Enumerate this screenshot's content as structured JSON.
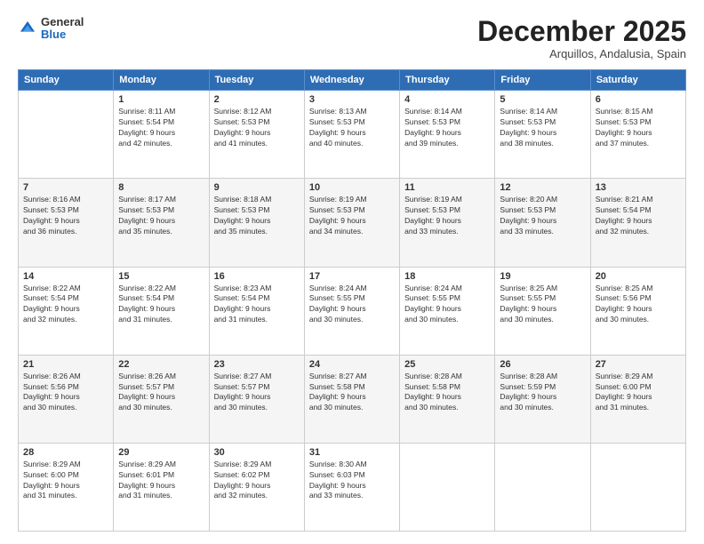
{
  "logo": {
    "general": "General",
    "blue": "Blue"
  },
  "title": "December 2025",
  "subtitle": "Arquillos, Andalusia, Spain",
  "days": [
    "Sunday",
    "Monday",
    "Tuesday",
    "Wednesday",
    "Thursday",
    "Friday",
    "Saturday"
  ],
  "weeks": [
    [
      {
        "day": "",
        "info": ""
      },
      {
        "day": "1",
        "info": "Sunrise: 8:11 AM\nSunset: 5:54 PM\nDaylight: 9 hours\nand 42 minutes."
      },
      {
        "day": "2",
        "info": "Sunrise: 8:12 AM\nSunset: 5:53 PM\nDaylight: 9 hours\nand 41 minutes."
      },
      {
        "day": "3",
        "info": "Sunrise: 8:13 AM\nSunset: 5:53 PM\nDaylight: 9 hours\nand 40 minutes."
      },
      {
        "day": "4",
        "info": "Sunrise: 8:14 AM\nSunset: 5:53 PM\nDaylight: 9 hours\nand 39 minutes."
      },
      {
        "day": "5",
        "info": "Sunrise: 8:14 AM\nSunset: 5:53 PM\nDaylight: 9 hours\nand 38 minutes."
      },
      {
        "day": "6",
        "info": "Sunrise: 8:15 AM\nSunset: 5:53 PM\nDaylight: 9 hours\nand 37 minutes."
      }
    ],
    [
      {
        "day": "7",
        "info": "Sunrise: 8:16 AM\nSunset: 5:53 PM\nDaylight: 9 hours\nand 36 minutes."
      },
      {
        "day": "8",
        "info": "Sunrise: 8:17 AM\nSunset: 5:53 PM\nDaylight: 9 hours\nand 35 minutes."
      },
      {
        "day": "9",
        "info": "Sunrise: 8:18 AM\nSunset: 5:53 PM\nDaylight: 9 hours\nand 35 minutes."
      },
      {
        "day": "10",
        "info": "Sunrise: 8:19 AM\nSunset: 5:53 PM\nDaylight: 9 hours\nand 34 minutes."
      },
      {
        "day": "11",
        "info": "Sunrise: 8:19 AM\nSunset: 5:53 PM\nDaylight: 9 hours\nand 33 minutes."
      },
      {
        "day": "12",
        "info": "Sunrise: 8:20 AM\nSunset: 5:53 PM\nDaylight: 9 hours\nand 33 minutes."
      },
      {
        "day": "13",
        "info": "Sunrise: 8:21 AM\nSunset: 5:54 PM\nDaylight: 9 hours\nand 32 minutes."
      }
    ],
    [
      {
        "day": "14",
        "info": "Sunrise: 8:22 AM\nSunset: 5:54 PM\nDaylight: 9 hours\nand 32 minutes."
      },
      {
        "day": "15",
        "info": "Sunrise: 8:22 AM\nSunset: 5:54 PM\nDaylight: 9 hours\nand 31 minutes."
      },
      {
        "day": "16",
        "info": "Sunrise: 8:23 AM\nSunset: 5:54 PM\nDaylight: 9 hours\nand 31 minutes."
      },
      {
        "day": "17",
        "info": "Sunrise: 8:24 AM\nSunset: 5:55 PM\nDaylight: 9 hours\nand 30 minutes."
      },
      {
        "day": "18",
        "info": "Sunrise: 8:24 AM\nSunset: 5:55 PM\nDaylight: 9 hours\nand 30 minutes."
      },
      {
        "day": "19",
        "info": "Sunrise: 8:25 AM\nSunset: 5:55 PM\nDaylight: 9 hours\nand 30 minutes."
      },
      {
        "day": "20",
        "info": "Sunrise: 8:25 AM\nSunset: 5:56 PM\nDaylight: 9 hours\nand 30 minutes."
      }
    ],
    [
      {
        "day": "21",
        "info": "Sunrise: 8:26 AM\nSunset: 5:56 PM\nDaylight: 9 hours\nand 30 minutes."
      },
      {
        "day": "22",
        "info": "Sunrise: 8:26 AM\nSunset: 5:57 PM\nDaylight: 9 hours\nand 30 minutes."
      },
      {
        "day": "23",
        "info": "Sunrise: 8:27 AM\nSunset: 5:57 PM\nDaylight: 9 hours\nand 30 minutes."
      },
      {
        "day": "24",
        "info": "Sunrise: 8:27 AM\nSunset: 5:58 PM\nDaylight: 9 hours\nand 30 minutes."
      },
      {
        "day": "25",
        "info": "Sunrise: 8:28 AM\nSunset: 5:58 PM\nDaylight: 9 hours\nand 30 minutes."
      },
      {
        "day": "26",
        "info": "Sunrise: 8:28 AM\nSunset: 5:59 PM\nDaylight: 9 hours\nand 30 minutes."
      },
      {
        "day": "27",
        "info": "Sunrise: 8:29 AM\nSunset: 6:00 PM\nDaylight: 9 hours\nand 31 minutes."
      }
    ],
    [
      {
        "day": "28",
        "info": "Sunrise: 8:29 AM\nSunset: 6:00 PM\nDaylight: 9 hours\nand 31 minutes."
      },
      {
        "day": "29",
        "info": "Sunrise: 8:29 AM\nSunset: 6:01 PM\nDaylight: 9 hours\nand 31 minutes."
      },
      {
        "day": "30",
        "info": "Sunrise: 8:29 AM\nSunset: 6:02 PM\nDaylight: 9 hours\nand 32 minutes."
      },
      {
        "day": "31",
        "info": "Sunrise: 8:30 AM\nSunset: 6:03 PM\nDaylight: 9 hours\nand 33 minutes."
      },
      {
        "day": "",
        "info": ""
      },
      {
        "day": "",
        "info": ""
      },
      {
        "day": "",
        "info": ""
      }
    ]
  ]
}
